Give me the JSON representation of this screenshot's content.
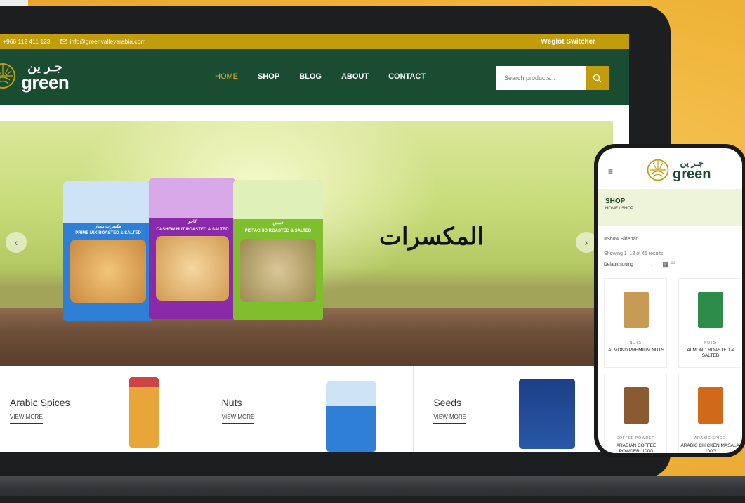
{
  "topbar": {
    "phone": "+966 112 411 123",
    "email": "info@greenvalleyarabia.com",
    "weglot": "Weglot Switcher"
  },
  "logo": {
    "arabic": "جـر ين",
    "english": "green"
  },
  "nav": {
    "items": [
      {
        "label": "HOME",
        "active": true
      },
      {
        "label": "SHOP"
      },
      {
        "label": "BLOG"
      },
      {
        "label": "ABOUT"
      },
      {
        "label": "CONTACT"
      }
    ]
  },
  "search": {
    "placeholder": "Search products..."
  },
  "hero": {
    "title": "المكسرات",
    "bags": [
      {
        "label": "PRIME MIX ROASTED & SALTED",
        "arabic": "مكسرات ممتاز",
        "color": "#2f7fd6"
      },
      {
        "label": "CASHEW NUT ROASTED & SALTED",
        "arabic": "كاجو",
        "color": "#8a2aa8"
      },
      {
        "label": "PISTACHIO ROASTED & SALTED",
        "arabic": "فستق",
        "color": "#7fbf2e"
      }
    ]
  },
  "categories": [
    {
      "name": "Arabic Spices",
      "more": "VIEW MORE"
    },
    {
      "name": "Nuts",
      "more": "VIEW MORE"
    },
    {
      "name": "Seeds",
      "more": "VIEW MORE"
    }
  ],
  "phone": {
    "banner_title": "SHOP",
    "breadcrumb": "HOME / SHOP",
    "sidebar": "Show Sidebar",
    "result_count": "Showing 1–12 of 46 results",
    "sort": "Default sorting",
    "products": [
      {
        "category": "NUTS",
        "name": "ALMOND PREMIUM NUTS",
        "color": "#c79b55"
      },
      {
        "category": "NUTS",
        "name": "ALMOND ROASTED & SALTED",
        "color": "#2d8c4a"
      },
      {
        "category": "COFFEE POWDER",
        "name": "ARABIAN COFFEE POWDER, 100G",
        "color": "#8a5a32"
      },
      {
        "category": "ARABIC SPICE",
        "name": "ARABIC CHICKEN MASALA, 100G",
        "color": "#d06a1a"
      }
    ]
  },
  "colors": {
    "brand_green": "#194c30",
    "gold": "#c19c0c"
  }
}
